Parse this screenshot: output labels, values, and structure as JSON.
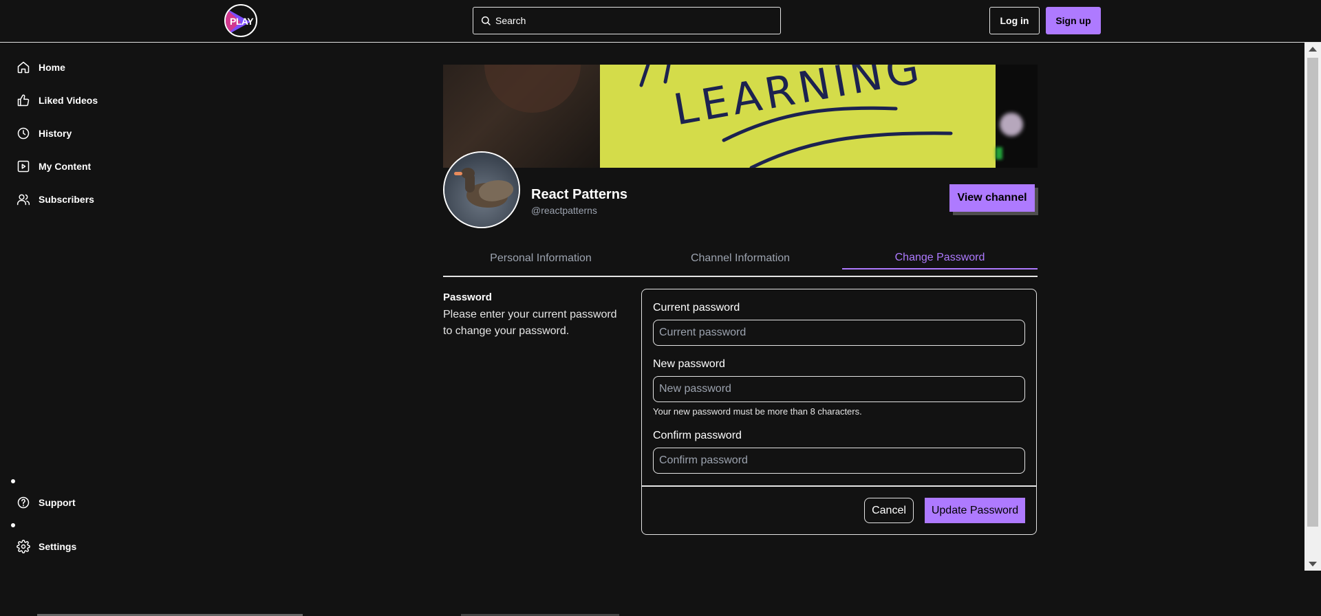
{
  "header": {
    "logo_text": "PLAY",
    "search_placeholder": "Search",
    "login_label": "Log in",
    "signup_label": "Sign up"
  },
  "sidebar": {
    "items": [
      {
        "label": "Home",
        "icon": "home-icon"
      },
      {
        "label": "Liked Videos",
        "icon": "thumbs-up-icon"
      },
      {
        "label": "History",
        "icon": "clock-icon"
      },
      {
        "label": "My Content",
        "icon": "video-icon"
      },
      {
        "label": "Subscribers",
        "icon": "users-icon"
      }
    ],
    "bottom_items": [
      {
        "label": "Support",
        "icon": "help-circle-icon"
      },
      {
        "label": "Settings",
        "icon": "gear-icon"
      }
    ]
  },
  "cover": {
    "text": "LEARNING"
  },
  "channel": {
    "name": "React Patterns",
    "handle": "@reactpatterns",
    "view_button": "View channel"
  },
  "tabs": [
    {
      "label": "Personal Information",
      "active": false
    },
    {
      "label": "Channel Information",
      "active": false
    },
    {
      "label": "Change Password",
      "active": true
    }
  ],
  "password_section": {
    "title": "Password",
    "description": "Please enter your current password to change your password."
  },
  "form": {
    "current": {
      "label": "Current password",
      "placeholder": "Current password"
    },
    "new": {
      "label": "New password",
      "placeholder": "New password",
      "hint": "Your new password must be more than 8 characters."
    },
    "confirm": {
      "label": "Confirm password",
      "placeholder": "Confirm password"
    },
    "cancel_label": "Cancel",
    "update_label": "Update Password"
  },
  "colors": {
    "accent": "#ae7aff",
    "background": "#121212",
    "border": "#e5e5e5"
  }
}
